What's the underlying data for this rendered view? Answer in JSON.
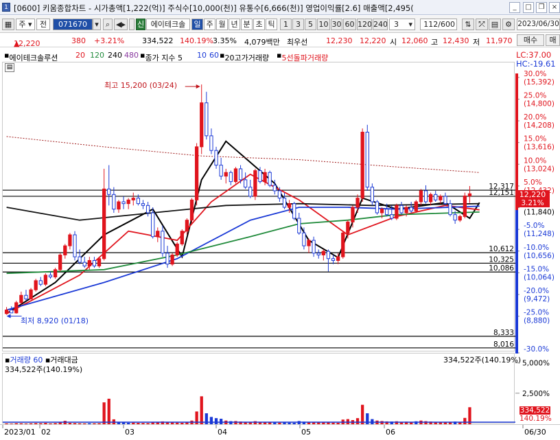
{
  "window": {
    "code_badge": "1",
    "title": "[0600] 키움종합차트 - 시가총액[1,222(억)] 주식수[10,000(천)] 유통수[6,666(천)] 영업이익률[2.6] 매출액[2,495("
  },
  "toolbar": {
    "period_label": "주",
    "prev_label": "전",
    "stock_code": "071670",
    "credit_badge": "신",
    "stock_name": "에이테크솔",
    "period_buttons": [
      "일",
      "주",
      "월",
      "년",
      "분",
      "초",
      "틱"
    ],
    "interval_buttons": [
      "1",
      "3",
      "5",
      "10",
      "30",
      "60",
      "120",
      "240"
    ],
    "interval_value": "3",
    "count_value": "112",
    "count_total": "/600",
    "date_value": "2023/06/30",
    "buy_label": "매수",
    "sell_label": "매"
  },
  "quote": {
    "price": "12,220",
    "direction": "▲",
    "change": "380",
    "change_pct": "+3.21%",
    "volume": "334,522",
    "volume_ratio": "140.19%",
    "turnover": "3.35%",
    "amount": "4,079백만",
    "prior_label": "최우선",
    "ask": "12,230",
    "bid": "12,220",
    "open_label": "시",
    "open": "12,060",
    "high_label": "고",
    "high": "12,430",
    "low_label": "저",
    "low": "11,970"
  },
  "legend": {
    "series_name": "에이테크솔루션",
    "ma_periods": [
      "20",
      "120",
      "240",
      "480"
    ],
    "close_index": "종가 지수 5",
    "close_index_periods": [
      "10",
      "60"
    ],
    "overlay_1": "20고가거래량",
    "overlay_2": "5선돌파거래량"
  },
  "right_panel": {
    "lc": "LC:37.00",
    "hc": "HC:-19.61",
    "price_box": "12,220",
    "pct_box": "3.21%"
  },
  "annotations": {
    "max_label": "최고 15,200 (03/24)",
    "min_label": "최저 8,920 (01/18)"
  },
  "volume_panel": {
    "title": "거래량",
    "period": "60",
    "amount_label": "거래대금",
    "left_value": "334,522주(140.19%)",
    "right_value": "334,522주(140.19%)",
    "box_value": "334,522",
    "box_pct": "140.19%"
  },
  "chart_data": {
    "type": "candlestick",
    "price_axis": {
      "ylim": [
        7900,
        15800
      ],
      "ticks": [
        {
          "price": 15392,
          "pct": "30.0%"
        },
        {
          "price": 14800,
          "pct": "25.0%"
        },
        {
          "price": 14208,
          "pct": "20.0%"
        },
        {
          "price": 13616,
          "pct": "15.0%"
        },
        {
          "price": 13024,
          "pct": "10.0%"
        },
        {
          "price": 12432,
          "pct": "5.0%"
        },
        {
          "price": 11840,
          "pct": "0.0%"
        },
        {
          "price": 11248,
          "pct": "-5.0%"
        },
        {
          "price": 10656,
          "pct": "-10.0%"
        },
        {
          "price": 10064,
          "pct": "-15.0%"
        },
        {
          "price": 9472,
          "pct": "-20.0%"
        },
        {
          "price": 8880,
          "pct": "-25.0%"
        },
        {
          "price": null,
          "pct": "-30.0%"
        }
      ]
    },
    "horizontal_lines": [
      12317,
      12151,
      10612,
      10325,
      10086,
      8333,
      8016
    ],
    "x_axis_labels": [
      "2023/01",
      "02",
      "03",
      "04",
      "05",
      "06",
      "06/30"
    ],
    "candles": [
      [
        8950,
        9130,
        8920,
        9050
      ],
      [
        9050,
        9150,
        8990,
        8970
      ],
      [
        8970,
        9300,
        8950,
        9250
      ],
      [
        9250,
        9550,
        9200,
        9450
      ],
      [
        9450,
        9600,
        9300,
        9350
      ],
      [
        9350,
        9650,
        9330,
        9600
      ],
      [
        9600,
        9900,
        9550,
        9850
      ],
      [
        9850,
        9950,
        9700,
        9750
      ],
      [
        9750,
        10050,
        9700,
        10000
      ],
      [
        10000,
        10100,
        9900,
        9950
      ],
      [
        9950,
        10200,
        9900,
        10150
      ],
      [
        10150,
        10600,
        10100,
        10550
      ],
      [
        10550,
        10850,
        10450,
        10800
      ],
      [
        10800,
        11150,
        10700,
        11100
      ],
      [
        11100,
        11200,
        10400,
        10500
      ],
      [
        10500,
        10700,
        10300,
        10350
      ],
      [
        10350,
        10500,
        10200,
        10250
      ],
      [
        10250,
        10500,
        10150,
        10400
      ],
      [
        10400,
        10500,
        10200,
        10250
      ],
      [
        10250,
        10500,
        10200,
        10450
      ],
      [
        10450,
        12900,
        10400,
        12350
      ],
      [
        12350,
        13000,
        11900,
        12200
      ],
      [
        12200,
        12400,
        11700,
        11800
      ],
      [
        11800,
        12050,
        11700,
        12000
      ],
      [
        12000,
        12150,
        11800,
        11950
      ],
      [
        11950,
        12100,
        11800,
        12050
      ],
      [
        12050,
        12250,
        11900,
        12100
      ],
      [
        12100,
        12200,
        11900,
        11950
      ],
      [
        11950,
        12050,
        11800,
        11900
      ],
      [
        11900,
        12000,
        11600,
        11700
      ],
      [
        11700,
        11850,
        11000,
        11050
      ],
      [
        11050,
        11300,
        10900,
        11200
      ],
      [
        11200,
        11350,
        10500,
        10600
      ],
      [
        10600,
        10800,
        10200,
        10300
      ],
      [
        10300,
        10600,
        10250,
        10550
      ],
      [
        10550,
        10900,
        10500,
        10850
      ],
      [
        10850,
        11250,
        10800,
        11200
      ],
      [
        11200,
        11550,
        11100,
        11500
      ],
      [
        11500,
        12100,
        11400,
        12050
      ],
      [
        12050,
        13600,
        11900,
        13500
      ],
      [
        13500,
        15200,
        13300,
        14700
      ],
      [
        14700,
        15000,
        13700,
        13800
      ],
      [
        13800,
        14000,
        13300,
        13400
      ],
      [
        13400,
        13500,
        12900,
        13000
      ],
      [
        13000,
        13200,
        12600,
        12700
      ],
      [
        12700,
        12900,
        12500,
        12800
      ],
      [
        12800,
        12850,
        12450,
        12550
      ],
      [
        12550,
        12950,
        12500,
        12900
      ],
      [
        12900,
        13000,
        12500,
        12600
      ],
      [
        12600,
        12800,
        12350,
        12400
      ],
      [
        12400,
        12600,
        12100,
        12150
      ],
      [
        12150,
        12900,
        12050,
        12850
      ],
      [
        12850,
        12950,
        12500,
        12550
      ],
      [
        12550,
        12900,
        12450,
        12800
      ],
      [
        12800,
        12850,
        12400,
        12450
      ],
      [
        12450,
        12600,
        12200,
        12300
      ],
      [
        12300,
        12400,
        12000,
        12100
      ],
      [
        12100,
        12250,
        11800,
        11850
      ],
      [
        11850,
        12050,
        11700,
        11950
      ],
      [
        11950,
        12000,
        11500,
        11550
      ],
      [
        11550,
        11700,
        11100,
        11150
      ],
      [
        11150,
        11300,
        10700,
        10800
      ],
      [
        10800,
        11000,
        10600,
        10950
      ],
      [
        10950,
        11050,
        10500,
        10600
      ],
      [
        10600,
        10700,
        10450,
        10550
      ],
      [
        10550,
        10700,
        10400,
        10650
      ],
      [
        10650,
        10700,
        10100,
        10450
      ],
      [
        10450,
        10550,
        10300,
        10400
      ],
      [
        10400,
        10600,
        10300,
        10500
      ],
      [
        10500,
        11200,
        10450,
        11150
      ],
      [
        11150,
        11500,
        11000,
        11450
      ],
      [
        11450,
        11900,
        11300,
        11850
      ],
      [
        11850,
        12200,
        11700,
        12100
      ],
      [
        12100,
        14000,
        12000,
        13900
      ],
      [
        13900,
        14100,
        12300,
        12400
      ],
      [
        12400,
        12500,
        11900,
        12000
      ],
      [
        12000,
        12050,
        11650,
        11700
      ],
      [
        11700,
        11850,
        11550,
        11800
      ],
      [
        11800,
        11950,
        11600,
        11650
      ],
      [
        11650,
        11900,
        11500,
        11550
      ],
      [
        11550,
        11950,
        11500,
        11900
      ],
      [
        11900,
        12000,
        11650,
        11700
      ],
      [
        11700,
        11900,
        11600,
        11850
      ],
      [
        11850,
        12000,
        11700,
        11750
      ],
      [
        11750,
        12050,
        11700,
        12000
      ],
      [
        12000,
        12350,
        11900,
        12300
      ],
      [
        12300,
        12450,
        11950,
        12000
      ],
      [
        12000,
        12250,
        11900,
        12200
      ],
      [
        12200,
        12300,
        12000,
        12050
      ],
      [
        12050,
        12200,
        11950,
        12150
      ],
      [
        12150,
        12250,
        11900,
        11950
      ],
      [
        11950,
        12050,
        11600,
        11650
      ],
      [
        11650,
        11750,
        11400,
        11500
      ],
      [
        11500,
        11650,
        11450,
        11600
      ],
      [
        11600,
        12250,
        11550,
        12160
      ],
      [
        12160,
        12430,
        11970,
        12220
      ]
    ],
    "ma_lines": [
      {
        "name": "5",
        "color": "#000000",
        "values": [
          [
            0,
            8950
          ],
          [
            10,
            9800
          ],
          [
            20,
            11100
          ],
          [
            30,
            11800
          ],
          [
            36,
            10500
          ],
          [
            40,
            12600
          ],
          [
            45,
            13650
          ],
          [
            55,
            12500
          ],
          [
            62,
            10950
          ],
          [
            68,
            10480
          ],
          [
            73,
            12100
          ],
          [
            80,
            11800
          ],
          [
            90,
            11980
          ],
          [
            95,
            11550
          ],
          [
            97,
            11980
          ]
        ]
      },
      {
        "name": "20",
        "color": "#e0141d",
        "values": [
          [
            0,
            8950
          ],
          [
            15,
            10000
          ],
          [
            25,
            11200
          ],
          [
            35,
            10950
          ],
          [
            42,
            12000
          ],
          [
            50,
            12750
          ],
          [
            60,
            12050
          ],
          [
            70,
            11100
          ],
          [
            80,
            11600
          ],
          [
            90,
            11900
          ],
          [
            97,
            11780
          ]
        ]
      },
      {
        "name": "120",
        "color": "#1a39d6",
        "values": [
          [
            0,
            9050
          ],
          [
            20,
            9800
          ],
          [
            35,
            10450
          ],
          [
            50,
            11500
          ],
          [
            60,
            11850
          ],
          [
            70,
            11850
          ],
          [
            80,
            11800
          ],
          [
            97,
            11880
          ]
        ]
      },
      {
        "name": "240",
        "color": "#1f8a3a",
        "values": [
          [
            0,
            10050
          ],
          [
            20,
            10150
          ],
          [
            35,
            10550
          ],
          [
            50,
            11050
          ],
          [
            60,
            11400
          ],
          [
            70,
            11500
          ],
          [
            80,
            11650
          ],
          [
            97,
            11720
          ]
        ]
      },
      {
        "name": "480",
        "color": "#111111",
        "values": [
          [
            0,
            11850
          ],
          [
            15,
            11500
          ],
          [
            30,
            11700
          ],
          [
            45,
            11900
          ],
          [
            60,
            11950
          ],
          [
            75,
            11900
          ],
          [
            97,
            11950
          ]
        ]
      },
      {
        "name": "20고가거래량",
        "color": "#a01a1a",
        "values": [
          [
            0,
            13780
          ],
          [
            20,
            13500
          ],
          [
            40,
            13250
          ],
          [
            60,
            13150
          ],
          [
            80,
            12950
          ],
          [
            97,
            12800
          ]
        ]
      }
    ],
    "volume": {
      "ylim": [
        0,
        5600000
      ],
      "ticks": [
        5000000,
        2500000
      ],
      "tick_labels": [
        "5,000%",
        "2,500%"
      ],
      "bars": [
        60,
        40,
        80,
        70,
        50,
        70,
        90,
        80,
        110,
        60,
        90,
        140,
        280,
        110,
        90,
        70,
        60,
        80,
        70,
        80,
        1800,
        2100,
        400,
        200,
        150,
        120,
        130,
        110,
        100,
        90,
        200,
        180,
        230,
        160,
        150,
        130,
        120,
        180,
        300,
        1050,
        2300,
        900,
        600,
        500,
        450,
        300,
        250,
        260,
        220,
        200,
        180,
        250,
        200,
        180,
        150,
        140,
        130,
        150,
        130,
        120,
        260,
        210,
        180,
        170,
        150,
        140,
        160,
        130,
        120,
        380,
        420,
        340,
        500,
        1600,
        900,
        420,
        300,
        260,
        230,
        220,
        240,
        200,
        210,
        190,
        240,
        300,
        250,
        220,
        200,
        190,
        180,
        200,
        220,
        200,
        520,
        1400
      ],
      "blue_indexes": [
        17,
        23,
        24,
        25,
        41,
        42,
        43,
        44,
        46,
        55,
        57,
        58,
        59,
        60,
        61,
        74,
        75,
        79,
        84,
        92
      ]
    }
  }
}
